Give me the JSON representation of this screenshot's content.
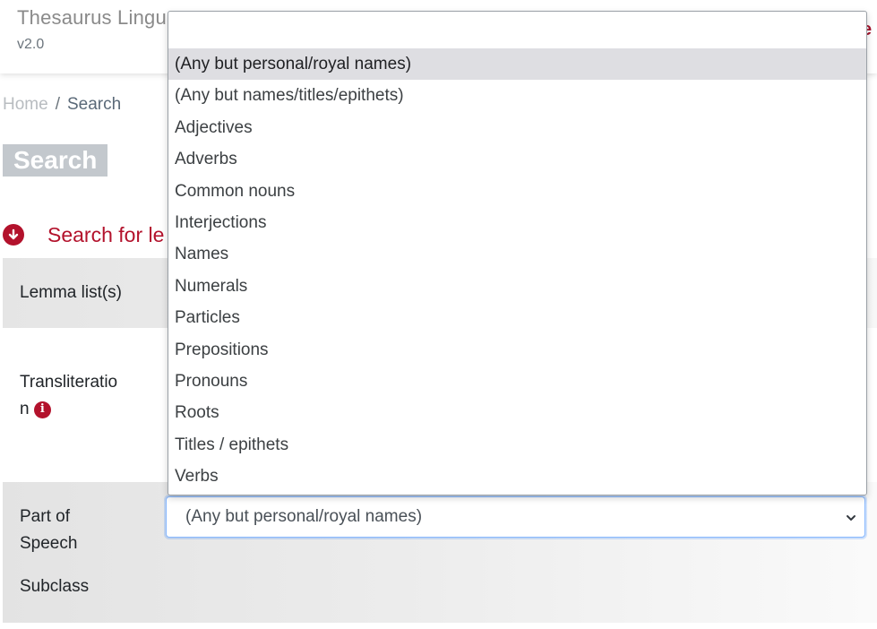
{
  "header": {
    "title": "Thesaurus Lingu",
    "version": "v2.0",
    "nav_partial": "e"
  },
  "breadcrumb": {
    "home": "Home",
    "separator": "/",
    "current": "Search"
  },
  "page_title": "Search",
  "section": {
    "label": "Search for le",
    "icon": "arrow-down-circle-icon"
  },
  "form": {
    "lemma_list_label": "Lemma list(s)",
    "transliteration_label_line1": "Transliteratio",
    "transliteration_label_line2": "n",
    "info_icon_glyph": "i",
    "pos_label_line1": "Part of",
    "pos_label_line2": "Speech",
    "subclass_label": "Subclass",
    "pos_selected": "(Any but personal/royal names)"
  },
  "dropdown": {
    "options": [
      "(Any but personal/royal names)",
      "(Any but names/titles/epithets)",
      "Adjectives",
      "Adverbs",
      "Common nouns",
      "Interjections",
      "Names",
      "Numerals",
      "Particles",
      "Prepositions",
      "Pronouns",
      "Roots",
      "Titles / epithets",
      "Verbs"
    ],
    "highlighted_index": 0
  },
  "colors": {
    "accent": "#b3122c",
    "title_badge_bg": "#c3c8cd",
    "highlight_bg": "#dedee2",
    "focus_border": "#86b7fe"
  }
}
